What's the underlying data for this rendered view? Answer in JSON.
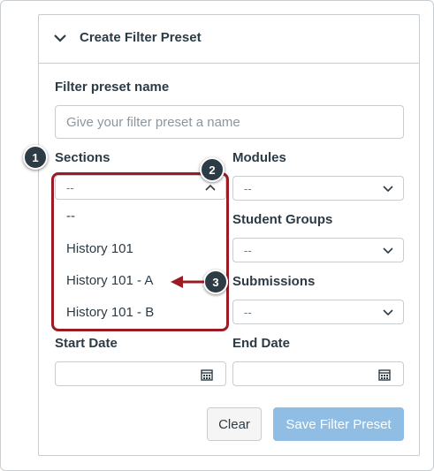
{
  "panel": {
    "title": "Create Filter Preset"
  },
  "form": {
    "name_label": "Filter preset name",
    "name_placeholder": "Give your filter preset a name",
    "sections_label": "Sections",
    "sections_value": "--",
    "sections_options": [
      "--",
      "History 101",
      "History 101 - A",
      "History 101 - B"
    ],
    "modules_label": "Modules",
    "modules_value": "--",
    "student_groups_label": "Student Groups",
    "student_groups_value": "--",
    "submissions_label": "Submissions",
    "submissions_value": "--",
    "start_date_label": "Start Date",
    "end_date_label": "End Date"
  },
  "buttons": {
    "clear": "Clear",
    "save": "Save Filter Preset"
  },
  "callouts": [
    "1",
    "2",
    "3"
  ],
  "colors": {
    "highlight": "#9b1b25",
    "badge": "#2d3b45",
    "save_button": "#8fbde3"
  }
}
